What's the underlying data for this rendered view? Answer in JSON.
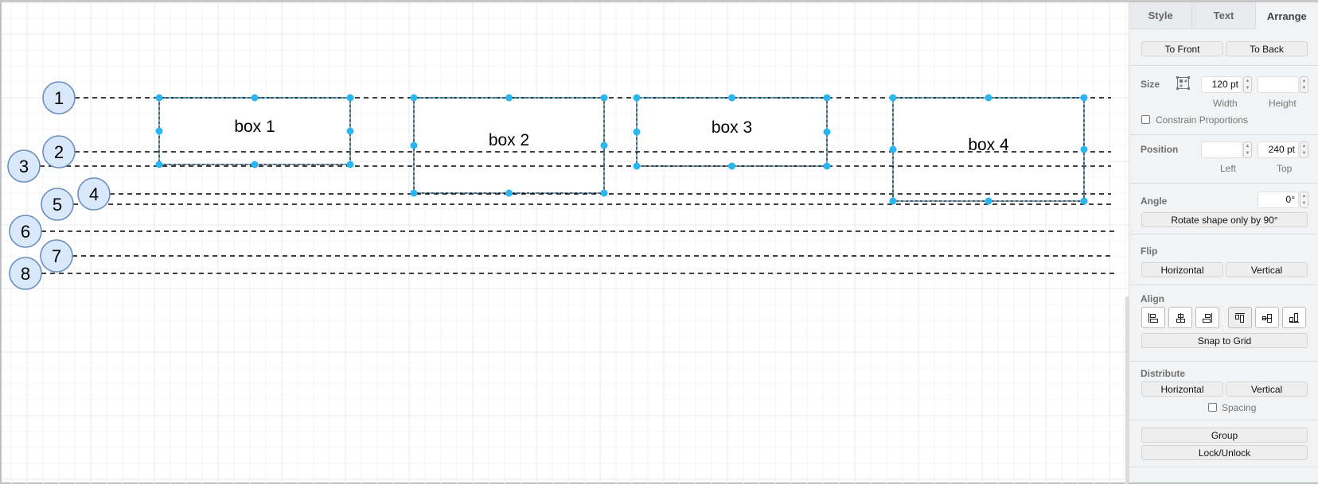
{
  "diagram": {
    "boxes": [
      {
        "id": "box1",
        "label": "box 1"
      },
      {
        "id": "box2",
        "label": "box 2"
      },
      {
        "id": "box3",
        "label": "box 3"
      },
      {
        "id": "box4",
        "label": "box 4"
      }
    ],
    "markers": [
      {
        "label": "1"
      },
      {
        "label": "2"
      },
      {
        "label": "3"
      },
      {
        "label": "4"
      },
      {
        "label": "5"
      },
      {
        "label": "6"
      },
      {
        "label": "7"
      },
      {
        "label": "8"
      }
    ],
    "colors": {
      "marker_fill": "#dae8fc",
      "marker_stroke": "#6c8ebf",
      "handle": "#29b6f2",
      "guide": "#000000"
    }
  },
  "panel": {
    "tabs": [
      {
        "label": "Style",
        "active": false
      },
      {
        "label": "Text",
        "active": false
      },
      {
        "label": "Arrange",
        "active": true
      }
    ],
    "order": {
      "to_front": "To Front",
      "to_back": "To Back"
    },
    "size": {
      "label": "Size",
      "width_value": "120 pt",
      "height_value": "",
      "width_label": "Width",
      "height_label": "Height",
      "constrain_label": "Constrain Proportions",
      "constrain_checked": false
    },
    "position": {
      "label": "Position",
      "left_value": "",
      "top_value": "240 pt",
      "left_label": "Left",
      "top_label": "Top"
    },
    "angle": {
      "label": "Angle",
      "value": "0°",
      "rotate_button": "Rotate shape only by 90°"
    },
    "flip": {
      "label": "Flip",
      "horizontal": "Horizontal",
      "vertical": "Vertical"
    },
    "align": {
      "label": "Align",
      "icons": [
        "align-left-icon",
        "align-center-icon",
        "align-right-icon",
        "align-top-icon",
        "align-middle-icon",
        "align-bottom-icon"
      ],
      "snap_button": "Snap to Grid"
    },
    "distribute": {
      "label": "Distribute",
      "horizontal": "Horizontal",
      "vertical": "Vertical",
      "spacing_label": "Spacing",
      "spacing_checked": false
    },
    "group": {
      "group_button": "Group",
      "lock_button": "Lock/Unlock"
    }
  }
}
